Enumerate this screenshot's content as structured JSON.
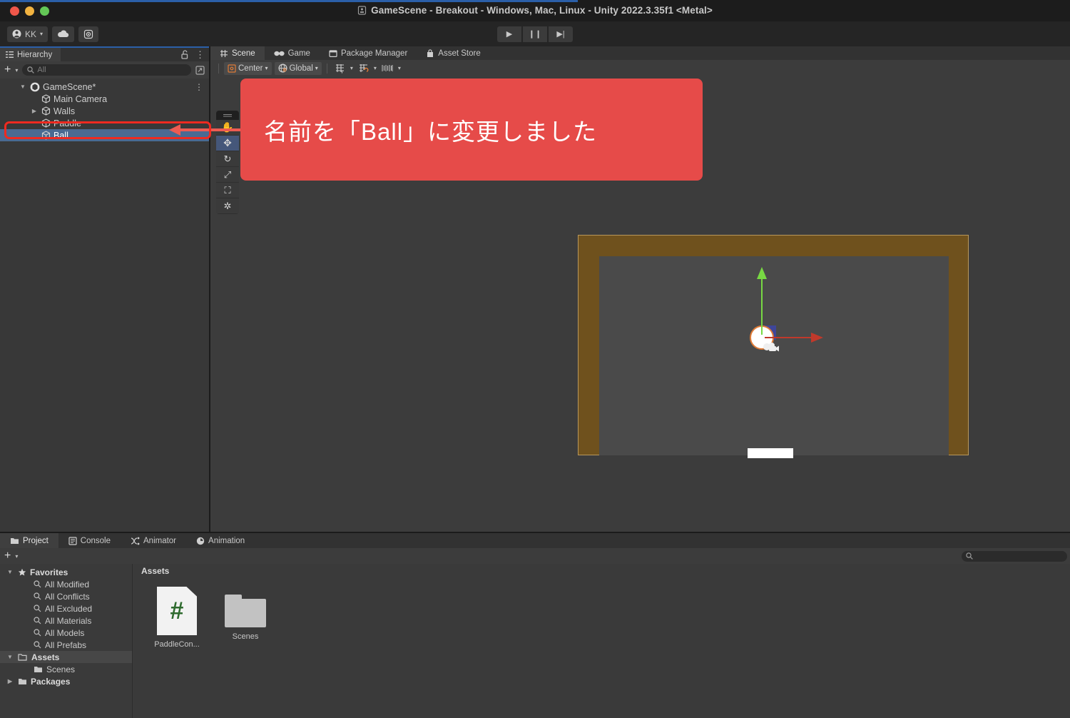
{
  "window": {
    "title": "GameScene - Breakout - Windows, Mac, Linux - Unity 2022.3.35f1 <Metal>",
    "title_icon": "unity-scene-icon",
    "traffic_lights": [
      "close",
      "minimize",
      "maximize"
    ]
  },
  "toolbar": {
    "account_label": "KK",
    "account_icon": "person-icon",
    "account_caret": "▾",
    "cloud_icon": "cloud-icon",
    "services_icon": "services-gear-icon",
    "play_icon": "▶",
    "pause_icon": "❙❙",
    "step_icon": "▶|"
  },
  "hierarchy": {
    "tab_label": "Hierarchy",
    "tab_icon": "hierarchy-icon",
    "lock_icon": "lock-open-icon",
    "menu_icon": "⋮",
    "add_label": "+",
    "add_caret": "▾",
    "search_placeholder": "All",
    "search_value": "",
    "search_icon": "search-icon",
    "expand_icon": "expand-window-icon",
    "items": [
      {
        "label": "GameScene*",
        "depth": 0,
        "twisty": "▼",
        "icon": "unity-scene-icon",
        "selected": false,
        "menu": "⋮"
      },
      {
        "label": "Main Camera",
        "depth": 1,
        "twisty": "",
        "icon": "gameobject-icon",
        "selected": false
      },
      {
        "label": "Walls",
        "depth": 1,
        "twisty": "▶",
        "icon": "gameobject-icon",
        "selected": false
      },
      {
        "label": "Paddle",
        "depth": 1,
        "twisty": "",
        "icon": "gameobject-icon",
        "selected": false
      },
      {
        "label": "Ball",
        "depth": 1,
        "twisty": "",
        "icon": "gameobject-icon",
        "selected": true
      }
    ]
  },
  "scene_dock": {
    "tabs": [
      {
        "label": "Scene",
        "icon": "scene-grid-icon",
        "active": true
      },
      {
        "label": "Game",
        "icon": "game-controller-icon",
        "active": false
      },
      {
        "label": "Package Manager",
        "icon": "package-icon",
        "active": false
      },
      {
        "label": "Asset Store",
        "icon": "store-bag-icon",
        "active": false
      }
    ],
    "toolbar": {
      "pivot_label": "Center",
      "pivot_icon": "pivot-center-icon",
      "pivot_caret": "▾",
      "handle_label": "Global",
      "handle_icon": "globe-icon",
      "handle_caret": "▾",
      "grid_icon": "grid-visibility-icon",
      "grid_caret": "▾",
      "snap_icon": "grid-snap-icon",
      "snap_caret": "▾",
      "layers_icon": "layer-ruler-icon",
      "layers_caret": "▾"
    },
    "tool_palette": [
      {
        "name": "hand-tool",
        "glyph": "✋",
        "active": false
      },
      {
        "name": "move-tool",
        "glyph": "✥",
        "active": true
      },
      {
        "name": "rotate-tool",
        "glyph": "↺",
        "active": false
      },
      {
        "name": "scale-tool",
        "glyph": "⤡",
        "active": false
      },
      {
        "name": "rect-tool",
        "glyph": "⧉",
        "active": false
      },
      {
        "name": "transform-tool",
        "glyph": "❂",
        "active": false
      }
    ]
  },
  "scene_objects": {
    "wall_color": "#6f511d",
    "playfield_color": "#4a4a4a",
    "ball_color": "#ffffff",
    "ball_outline_color": "#e07b36",
    "paddle_color": "#ffffff",
    "gizmo_y_color": "#78d843",
    "gizmo_x_color": "#c0392b",
    "gizmo_z_color": "#3c46b4",
    "camera_icon": "camera-icon"
  },
  "annotation": {
    "callout_text": "名前を「Ball」に変更しました",
    "callout_color": "#e64b49",
    "highlight_color": "#ee2a20",
    "arrow_color": "#ee5b52"
  },
  "project": {
    "tabs": [
      {
        "label": "Project",
        "icon": "folder-icon",
        "active": true
      },
      {
        "label": "Console",
        "icon": "console-icon",
        "active": false
      },
      {
        "label": "Animator",
        "icon": "animator-icon",
        "active": false
      },
      {
        "label": "Animation",
        "icon": "animation-clock-icon",
        "active": false
      }
    ],
    "add_label": "+",
    "add_caret": "▾",
    "search_value": "",
    "search_icon": "search-icon",
    "tree": [
      {
        "label": "Favorites",
        "depth": 0,
        "twisty": "▼",
        "icon": "star-icon",
        "head": true
      },
      {
        "label": "All Modified",
        "depth": 1,
        "twisty": "",
        "icon": "search-icon"
      },
      {
        "label": "All Conflicts",
        "depth": 1,
        "twisty": "",
        "icon": "search-icon"
      },
      {
        "label": "All Excluded",
        "depth": 1,
        "twisty": "",
        "icon": "search-icon"
      },
      {
        "label": "All Materials",
        "depth": 1,
        "twisty": "",
        "icon": "search-icon"
      },
      {
        "label": "All Models",
        "depth": 1,
        "twisty": "",
        "icon": "search-icon"
      },
      {
        "label": "All Prefabs",
        "depth": 1,
        "twisty": "",
        "icon": "search-icon"
      },
      {
        "label": "Assets",
        "depth": 0,
        "twisty": "▼",
        "icon": "folder-open-icon",
        "head": true,
        "selected": true
      },
      {
        "label": "Scenes",
        "depth": 1,
        "twisty": "",
        "icon": "folder-icon"
      },
      {
        "label": "Packages",
        "depth": 0,
        "twisty": "▶",
        "icon": "folder-icon",
        "head": true
      }
    ],
    "breadcrumb": "Assets",
    "assets": [
      {
        "label": "PaddleCon...",
        "type": "csharp-script"
      },
      {
        "label": "Scenes",
        "type": "folder"
      }
    ]
  }
}
